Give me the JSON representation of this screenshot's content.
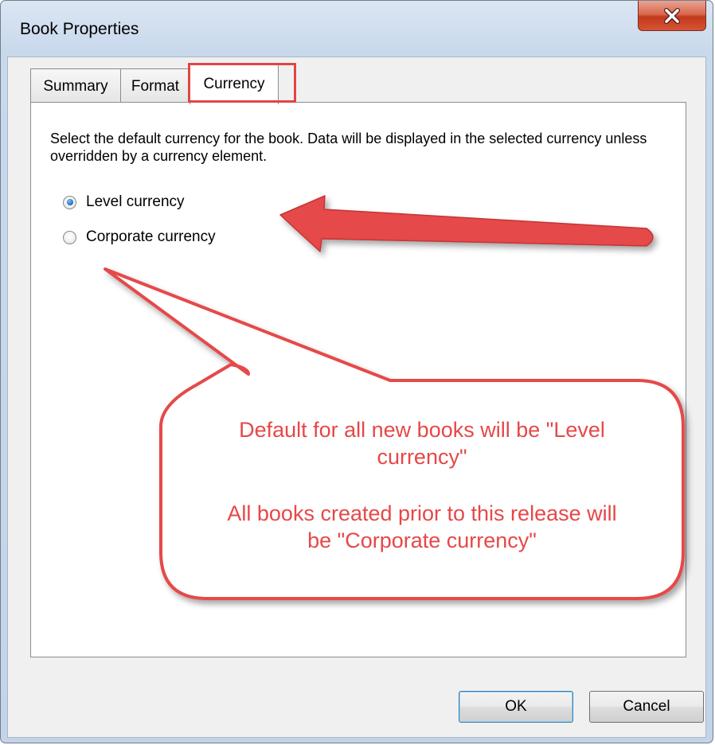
{
  "window": {
    "title": "Book Properties",
    "close_icon": "close-icon"
  },
  "tabs": [
    {
      "label": "Summary",
      "active": false
    },
    {
      "label": "Format",
      "active": false
    },
    {
      "label": "Currency",
      "active": true
    }
  ],
  "currency_panel": {
    "description": "Select the default currency for the book. Data will be displayed in the selected currency unless overridden by a currency element.",
    "options": [
      {
        "label": "Level currency",
        "selected": true
      },
      {
        "label": "Corporate currency",
        "selected": false
      }
    ]
  },
  "buttons": {
    "ok_label": "OK",
    "cancel_label": "Cancel"
  },
  "annotation": {
    "color": "#e64848",
    "callout_line1": "Default for all new books will be \"Level",
    "callout_line2": "currency\"",
    "callout_line3": "All books created prior to this release will",
    "callout_line4": "be \"Corporate currency\""
  }
}
